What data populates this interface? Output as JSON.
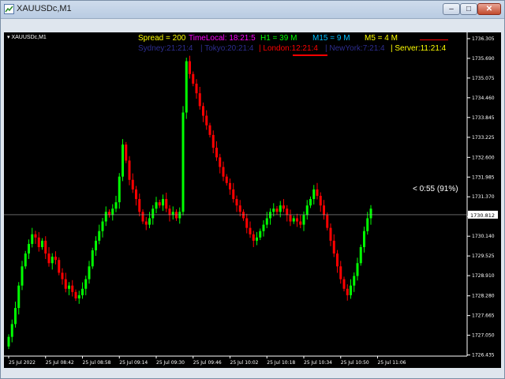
{
  "window": {
    "title": "XAUUSDc,M1"
  },
  "chart": {
    "symbol_label": "XAUUSDc,M1",
    "hud": {
      "spread": "Spread = 200",
      "time_local": "TimeLocal: 18:21:5",
      "h1": "H1 = 39 M",
      "m15": "M15 = 9 M",
      "m5": "M5 = 4 M",
      "sydney": "Sydney:21:21:4",
      "tokyo": "| Tokyo:20:21:4",
      "london": "| London:12:21:4",
      "newyork": "| NewYork:7:21:4",
      "server": "| Server:11:21:4"
    },
    "countdown": "< 0:55 (91%)",
    "current_price": "1730.812",
    "colors": {
      "up": "#00ff00",
      "down": "#ff0000",
      "background": "#000000",
      "spread": "#ffff00",
      "time_local": "#ff00ff",
      "h1": "#00ff00",
      "m15": "#00bfff",
      "m5": "#ffff00",
      "sydney": "#2d2d8f",
      "tokyo": "#2d2d8f",
      "london": "#ff0000",
      "newyork": "#2d2d8f",
      "server": "#ffff00"
    }
  },
  "chart_data": {
    "type": "candlestick",
    "ylim": [
      1726.4,
      1736.5
    ],
    "price_ticks": [
      "1736.305",
      "1735.690",
      "1735.075",
      "1734.460",
      "1733.845",
      "1733.225",
      "1732.600",
      "1731.985",
      "1731.370",
      "1730.755",
      "1730.140",
      "1729.525",
      "1728.910",
      "1728.280",
      "1727.665",
      "1727.050",
      "1726.435"
    ],
    "time_ticks": [
      "25 Jul 2022",
      "25 Jul 08:42",
      "25 Jul 08:58",
      "25 Jul 09:14",
      "25 Jul 09:30",
      "25 Jul 09:46",
      "25 Jul 10:02",
      "25 Jul 10:18",
      "25 Jul 10:34",
      "25 Jul 10:50",
      "25 Jul 11:06"
    ],
    "closes": [
      1727.0,
      1727.4,
      1727.9,
      1728.6,
      1729.2,
      1729.6,
      1729.9,
      1730.2,
      1730.1,
      1729.8,
      1730.0,
      1729.6,
      1729.3,
      1729.5,
      1729.4,
      1729.0,
      1728.8,
      1728.5,
      1728.6,
      1728.4,
      1728.2,
      1728.3,
      1728.5,
      1728.8,
      1729.2,
      1729.7,
      1730.0,
      1730.3,
      1730.6,
      1730.9,
      1730.8,
      1731.0,
      1731.2,
      1732.0,
      1733.0,
      1732.5,
      1731.9,
      1731.6,
      1731.3,
      1730.9,
      1730.6,
      1730.5,
      1730.7,
      1731.0,
      1731.2,
      1731.1,
      1731.3,
      1731.0,
      1730.8,
      1730.9,
      1730.7,
      1730.9,
      1734.0,
      1735.6,
      1735.2,
      1734.9,
      1734.6,
      1734.2,
      1733.9,
      1733.6,
      1733.3,
      1732.9,
      1732.6,
      1732.3,
      1732.0,
      1731.8,
      1731.6,
      1731.3,
      1731.1,
      1730.9,
      1730.7,
      1730.4,
      1730.2,
      1730.0,
      1730.1,
      1730.3,
      1730.5,
      1730.7,
      1730.9,
      1731.0,
      1730.9,
      1731.1,
      1731.0,
      1730.8,
      1730.6,
      1730.7,
      1730.6,
      1730.5,
      1730.8,
      1731.1,
      1731.3,
      1731.6,
      1731.4,
      1731.1,
      1730.8,
      1730.4,
      1730.0,
      1729.6,
      1729.2,
      1728.8,
      1728.5,
      1728.3,
      1728.6,
      1728.9,
      1729.3,
      1729.8,
      1730.3,
      1730.7,
      1731.0
    ]
  }
}
